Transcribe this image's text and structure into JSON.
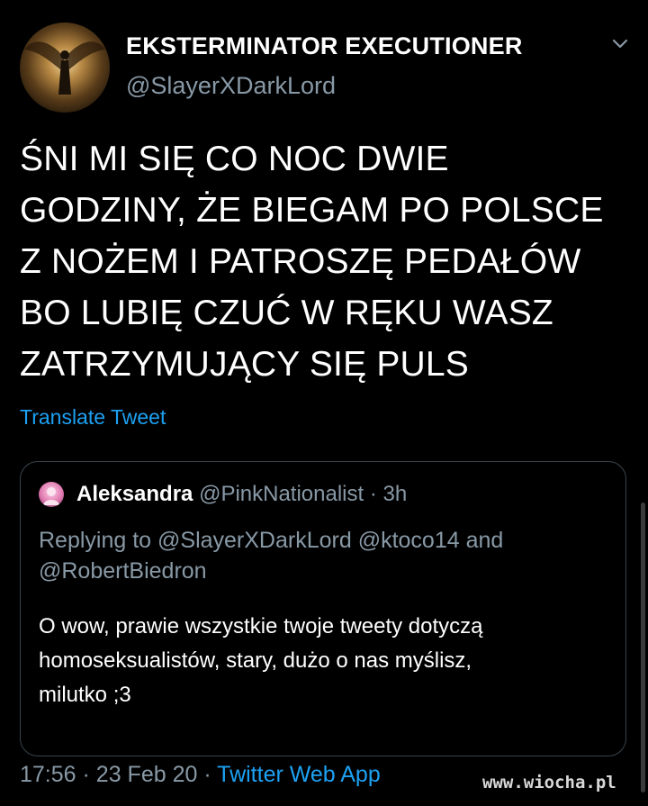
{
  "tweet": {
    "author_name": "EKSTERMINATOR EXECUTIONER",
    "author_handle": "@SlayerXDarkLord",
    "text_lines": [
      "ŚNI MI SIĘ CO NOC DWIE",
      "GODZINY, ŻE BIEGAM PO POLSCE",
      "Z NOŻEM I PATROSZĘ PEDAŁÓW",
      "BO LUBIĘ CZUĆ W RĘKU WASZ",
      "ZATRZYMUJĄCY SIĘ PULS"
    ],
    "translate_label": "Translate Tweet",
    "menu_icon": "chevron-down-icon"
  },
  "quote": {
    "author_name": "Aleksandra",
    "author_handle": "@PinkNationalist",
    "separator": "·",
    "time": "3h",
    "reply_lines": [
      "Replying to @SlayerXDarkLord @ktoco14 and",
      "@RobertBiedron"
    ],
    "body_lines": [
      "O wow, prawie wszystkie twoje tweety dotyczą",
      "homoseksualistów, stary, dużo o nas myślisz,",
      "milutko ;3"
    ]
  },
  "footer": {
    "time": "17:56",
    "separator": "·",
    "date": "23 Feb 20",
    "source": "Twitter Web App"
  },
  "watermark": "www.wiocha.pl",
  "colors": {
    "background": "#000000",
    "accent": "#1da1f2",
    "muted": "#8899a6",
    "border": "#38444d"
  }
}
